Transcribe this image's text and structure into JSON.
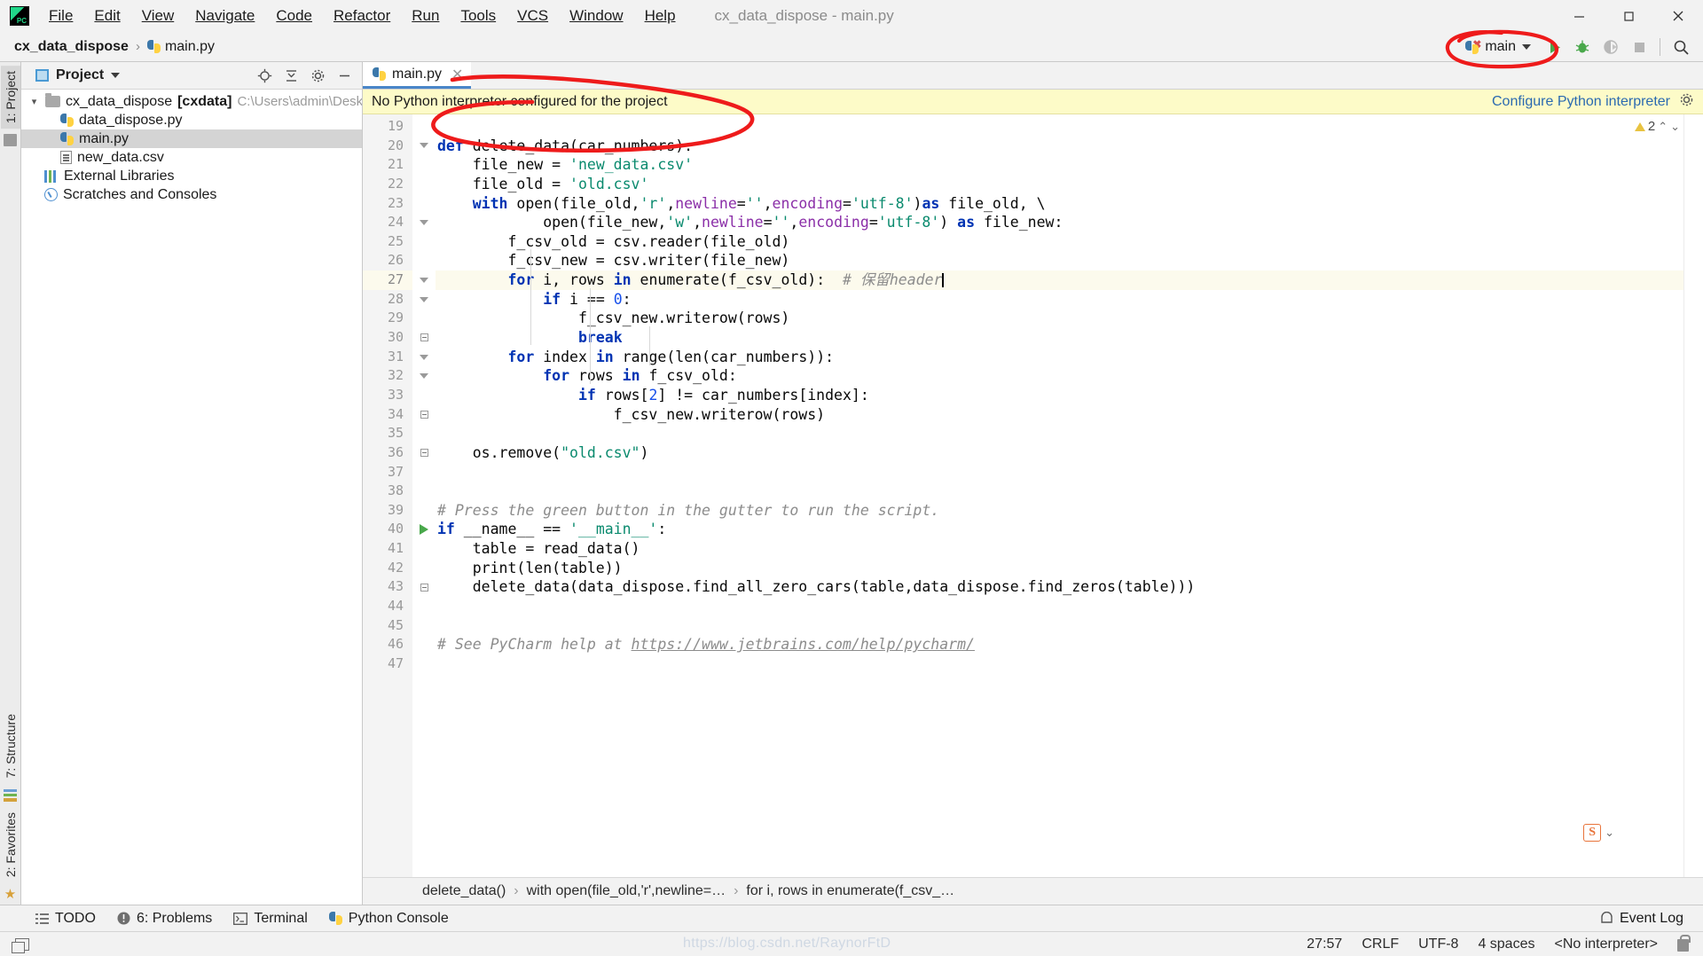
{
  "window": {
    "title": "cx_data_dispose - main.py",
    "app_icon": "pycharm-logo-icon",
    "minimize": "─",
    "maximize": "❐",
    "close": "✕"
  },
  "menubar": {
    "items": [
      {
        "label": "File"
      },
      {
        "label": "Edit"
      },
      {
        "label": "View"
      },
      {
        "label": "Navigate"
      },
      {
        "label": "Code"
      },
      {
        "label": "Refactor"
      },
      {
        "label": "Run"
      },
      {
        "label": "Tools"
      },
      {
        "label": "VCS"
      },
      {
        "label": "Window"
      },
      {
        "label": "Help"
      }
    ]
  },
  "navbar": {
    "breadcrumbs": [
      {
        "label": "cx_data_dispose",
        "icon": null
      },
      {
        "label": "main.py",
        "icon": "python-file-icon"
      }
    ],
    "separator": "›",
    "run_config": {
      "name": "main",
      "icon": "python-config-icon",
      "caret": "chevron-down-icon"
    },
    "buttons": [
      {
        "name": "run-button",
        "glyph": "▶"
      },
      {
        "name": "debug-button",
        "glyph": "🐞"
      },
      {
        "name": "run-with-coverage-button",
        "glyph": "◑"
      },
      {
        "name": "stop-button",
        "glyph": "■"
      },
      {
        "name": "search-everywhere-button",
        "glyph": "🔍"
      }
    ]
  },
  "left_stripe": {
    "top_tab": "1: Project",
    "structure_tab": "7: Structure",
    "favorites_tab": "2: Favorites"
  },
  "project": {
    "header_title": "Project",
    "header_caret": "chevron-down-icon",
    "actions": [
      "locate-icon",
      "collapse-all-icon",
      "settings-icon",
      "hide-icon"
    ],
    "tree": [
      {
        "label": "cx_data_dispose",
        "badge": "[cxdata]",
        "path": "C:\\Users\\admin\\Desktop\\cx_da",
        "icon": "folder-icon",
        "arrow": "⌄",
        "depth": 0,
        "selected": false
      },
      {
        "label": "data_dispose.py",
        "icon": "python-file-icon",
        "depth": 1,
        "selected": false
      },
      {
        "label": "main.py",
        "icon": "python-file-icon",
        "depth": 1,
        "selected": true
      },
      {
        "label": "new_data.csv",
        "icon": "csv-file-icon",
        "depth": 1,
        "selected": false
      },
      {
        "label": "External Libraries",
        "icon": "libraries-icon",
        "depth": 0,
        "selected": false
      },
      {
        "label": "Scratches and Consoles",
        "icon": "scratches-icon",
        "depth": 0,
        "selected": false
      }
    ]
  },
  "editor": {
    "tabs": [
      {
        "label": "main.py",
        "icon": "python-file-icon",
        "close": "✕",
        "active": true
      }
    ],
    "notification": {
      "message": "No Python interpreter configured for the project",
      "action_link": "Configure Python interpreter",
      "settings_icon": "gear-icon"
    },
    "inspection": {
      "warning_count": "2",
      "warning_icon": "warning-triangle-icon",
      "up_chevron": "⌃",
      "down_chevron": "⌄"
    },
    "first_line_number": 19,
    "current_line": 27,
    "run_gutter_line": 40,
    "lines": [
      {
        "n": 19,
        "tokens": []
      },
      {
        "n": 20,
        "fold": "tri",
        "tokens": [
          {
            "t": "def ",
            "c": "kw"
          },
          {
            "t": "delete_data(car_numbers):",
            "c": "plain"
          }
        ]
      },
      {
        "n": 21,
        "tokens": [
          {
            "t": "    file_new = ",
            "c": "plain"
          },
          {
            "t": "'new_data.csv'",
            "c": "str2"
          }
        ]
      },
      {
        "n": 22,
        "tokens": [
          {
            "t": "    file_old = ",
            "c": "plain"
          },
          {
            "t": "'old.csv'",
            "c": "str2"
          }
        ]
      },
      {
        "n": 23,
        "tokens": [
          {
            "t": "    ",
            "c": "plain"
          },
          {
            "t": "with ",
            "c": "kw"
          },
          {
            "t": "open(file_old,",
            "c": "plain"
          },
          {
            "t": "'r'",
            "c": "str2"
          },
          {
            "t": ",",
            "c": "plain"
          },
          {
            "t": "newline",
            "c": "kwarg"
          },
          {
            "t": "=",
            "c": "plain"
          },
          {
            "t": "''",
            "c": "str2"
          },
          {
            "t": ",",
            "c": "plain"
          },
          {
            "t": "encoding",
            "c": "kwarg"
          },
          {
            "t": "=",
            "c": "plain"
          },
          {
            "t": "'utf-8'",
            "c": "str2"
          },
          {
            "t": ")",
            "c": "plain"
          },
          {
            "t": "as",
            "c": "kw"
          },
          {
            "t": " file_old, \\",
            "c": "plain"
          }
        ]
      },
      {
        "n": 24,
        "fold": "tri",
        "tokens": [
          {
            "t": "            open(file_new,",
            "c": "plain"
          },
          {
            "t": "'w'",
            "c": "str2"
          },
          {
            "t": ",",
            "c": "plain"
          },
          {
            "t": "newline",
            "c": "kwarg"
          },
          {
            "t": "=",
            "c": "plain"
          },
          {
            "t": "''",
            "c": "str2"
          },
          {
            "t": ",",
            "c": "plain"
          },
          {
            "t": "encoding",
            "c": "kwarg"
          },
          {
            "t": "=",
            "c": "plain"
          },
          {
            "t": "'utf-8'",
            "c": "str2"
          },
          {
            "t": ") ",
            "c": "plain"
          },
          {
            "t": "as",
            "c": "kw"
          },
          {
            "t": " file_new:",
            "c": "plain"
          }
        ]
      },
      {
        "n": 25,
        "tokens": [
          {
            "t": "        f_csv_old = csv.reader(file_old)",
            "c": "plain"
          }
        ]
      },
      {
        "n": 26,
        "tokens": [
          {
            "t": "        f_csv_new = csv.writer(file_new)",
            "c": "plain"
          }
        ]
      },
      {
        "n": 27,
        "fold": "tri",
        "current": true,
        "tokens": [
          {
            "t": "        ",
            "c": "plain"
          },
          {
            "t": "for",
            "c": "kw"
          },
          {
            "t": " i, rows ",
            "c": "plain"
          },
          {
            "t": "in",
            "c": "kw"
          },
          {
            "t": " enumerate(f_csv_old):  ",
            "c": "plain"
          },
          {
            "t": "# 保留header",
            "c": "cmt"
          }
        ],
        "caret_at_end": true
      },
      {
        "n": 28,
        "fold": "tri",
        "tokens": [
          {
            "t": "            ",
            "c": "plain"
          },
          {
            "t": "if",
            "c": "kw"
          },
          {
            "t": " i == ",
            "c": "plain"
          },
          {
            "t": "0",
            "c": "num"
          },
          {
            "t": ":",
            "c": "plain"
          }
        ]
      },
      {
        "n": 29,
        "tokens": [
          {
            "t": "                f_csv_new.writerow(rows)",
            "c": "plain"
          }
        ]
      },
      {
        "n": 30,
        "fold": "open",
        "tokens": [
          {
            "t": "                ",
            "c": "plain"
          },
          {
            "t": "break",
            "c": "kw"
          }
        ]
      },
      {
        "n": 31,
        "fold": "tri",
        "tokens": [
          {
            "t": "        ",
            "c": "plain"
          },
          {
            "t": "for",
            "c": "kw"
          },
          {
            "t": " index ",
            "c": "plain"
          },
          {
            "t": "in",
            "c": "kw"
          },
          {
            "t": " range(len(car_numbers)):",
            "c": "plain"
          }
        ]
      },
      {
        "n": 32,
        "fold": "tri",
        "tokens": [
          {
            "t": "            ",
            "c": "plain"
          },
          {
            "t": "for",
            "c": "kw"
          },
          {
            "t": " rows ",
            "c": "plain"
          },
          {
            "t": "in",
            "c": "kw"
          },
          {
            "t": " f_csv_old:",
            "c": "plain"
          }
        ]
      },
      {
        "n": 33,
        "tokens": [
          {
            "t": "                ",
            "c": "plain"
          },
          {
            "t": "if",
            "c": "kw"
          },
          {
            "t": " rows[",
            "c": "plain"
          },
          {
            "t": "2",
            "c": "num"
          },
          {
            "t": "] != car_numbers[index]:",
            "c": "plain"
          }
        ]
      },
      {
        "n": 34,
        "fold": "open",
        "tokens": [
          {
            "t": "                    f_csv_new.writerow(rows)",
            "c": "plain"
          }
        ]
      },
      {
        "n": 35,
        "tokens": []
      },
      {
        "n": 36,
        "fold": "open",
        "tokens": [
          {
            "t": "    os.remove(",
            "c": "plain"
          },
          {
            "t": "\"old.csv\"",
            "c": "str2"
          },
          {
            "t": ")",
            "c": "plain"
          }
        ]
      },
      {
        "n": 37,
        "tokens": []
      },
      {
        "n": 38,
        "tokens": []
      },
      {
        "n": 39,
        "tokens": [
          {
            "t": "# Press the green button in the gutter to run the script.",
            "c": "cmt"
          }
        ]
      },
      {
        "n": 40,
        "fold": "tri",
        "run": true,
        "tokens": [
          {
            "t": "if",
            "c": "kw"
          },
          {
            "t": " __name__ == ",
            "c": "plain"
          },
          {
            "t": "'__main__'",
            "c": "str2"
          },
          {
            "t": ":",
            "c": "plain"
          }
        ]
      },
      {
        "n": 41,
        "tokens": [
          {
            "t": "    table = read_data()",
            "c": "plain"
          }
        ]
      },
      {
        "n": 42,
        "tokens": [
          {
            "t": "    print(len(table))",
            "c": "plain"
          }
        ]
      },
      {
        "n": 43,
        "fold": "open",
        "tokens": [
          {
            "t": "    delete_data(data_dispose.find_all_zero_cars(table,data_dispose.find_zeros(table)))",
            "c": "plain"
          }
        ]
      },
      {
        "n": 44,
        "tokens": []
      },
      {
        "n": 45,
        "tokens": []
      },
      {
        "n": 46,
        "tokens": [
          {
            "t": "# See PyCharm help at ",
            "c": "cmt"
          },
          {
            "t": "https://www.jetbrains.com/help/pycharm/",
            "c": "lnk"
          }
        ]
      },
      {
        "n": 47,
        "tokens": []
      }
    ],
    "floating_badge": {
      "label": "S",
      "caret": "⌄"
    },
    "breadcrumbs": [
      "delete_data()",
      "with open(file_old,'r',newline=…",
      "for i, rows in enumerate(f_csv_…"
    ],
    "breadcrumb_sep": "›"
  },
  "toolwindow_bar": {
    "items": [
      {
        "label": "TODO",
        "icon": "todo-list-icon"
      },
      {
        "label": "6: Problems",
        "icon": "problems-icon"
      },
      {
        "label": "Terminal",
        "icon": "terminal-icon"
      },
      {
        "label": "Python Console",
        "icon": "python-console-icon"
      }
    ],
    "event_log": {
      "label": "Event Log",
      "icon": "event-log-icon"
    }
  },
  "statusbar": {
    "position": "27:57",
    "line_separator": "CRLF",
    "encoding": "UTF-8",
    "indent": "4 spaces",
    "interpreter": "<No interpreter>",
    "lock_icon": "lock-icon",
    "layout_icon": "window-layout-icon",
    "watermark": "https://blog.csdn.net/RaynorFtD"
  },
  "colors": {
    "accent_blue": "#4a86c8",
    "notification_bg": "#fdfbc8",
    "annotation_red": "#ee1b1b",
    "keyword": "#0033b3",
    "string": "#0a8a6e",
    "kwarg": "#8b2fa8",
    "comment": "#8c8c8c",
    "run_green": "#49a84b"
  }
}
